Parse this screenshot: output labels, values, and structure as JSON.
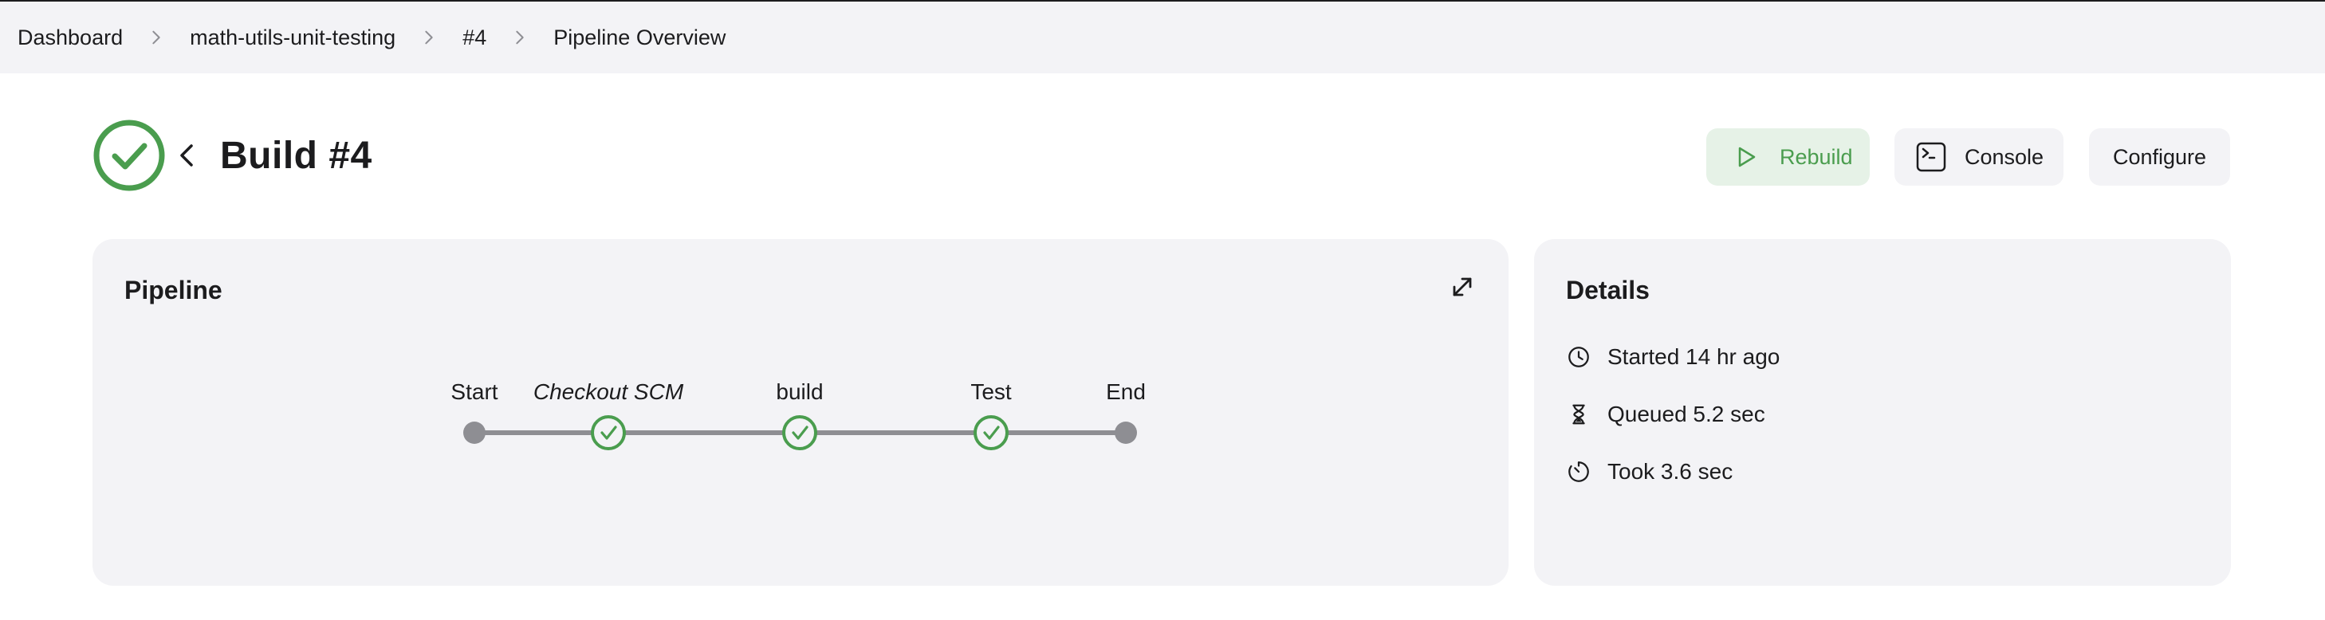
{
  "breadcrumb": {
    "items": [
      "Dashboard",
      "math-utils-unit-testing",
      "#4",
      "Pipeline Overview"
    ]
  },
  "header": {
    "title": "Build #4",
    "status": "success",
    "status_color": "#4a9d4e"
  },
  "actions": {
    "rebuild_label": "Rebuild",
    "console_label": "Console",
    "configure_label": "Configure"
  },
  "pipeline": {
    "title": "Pipeline",
    "stages": [
      {
        "label": "Start",
        "status": "terminal"
      },
      {
        "label": "Checkout SCM",
        "status": "success"
      },
      {
        "label": "build",
        "status": "success"
      },
      {
        "label": "Test",
        "status": "success"
      },
      {
        "label": "End",
        "status": "terminal"
      }
    ]
  },
  "details": {
    "title": "Details",
    "items": [
      {
        "icon": "clock-icon",
        "text": "Started 14 hr ago"
      },
      {
        "icon": "hourglass-icon",
        "text": "Queued 5.2 sec"
      },
      {
        "icon": "timer-icon",
        "text": "Took 3.6 sec"
      }
    ]
  }
}
